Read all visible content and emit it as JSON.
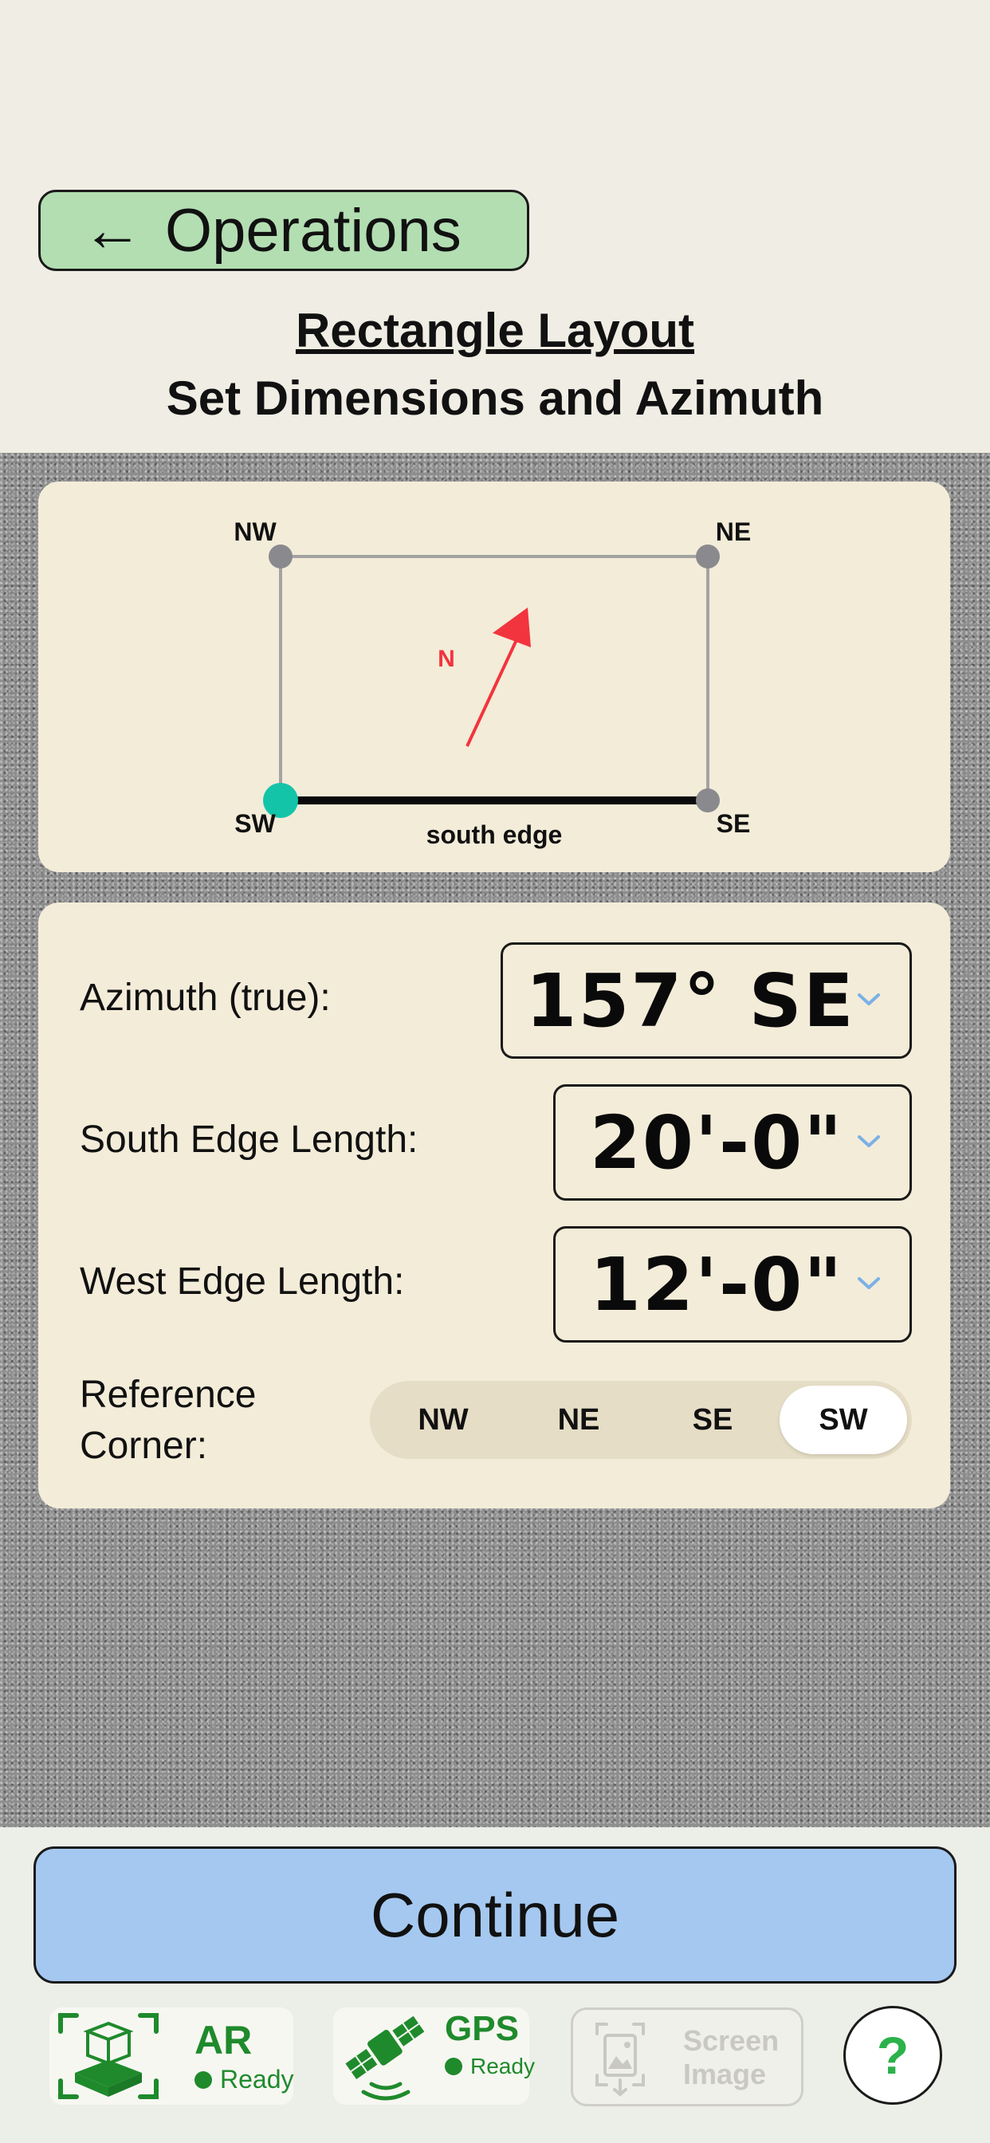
{
  "header": {
    "back_label": "Operations",
    "title": "Rectangle Layout",
    "subtitle": "Set Dimensions and Azimuth"
  },
  "diagram": {
    "corners": {
      "nw": "NW",
      "ne": "NE",
      "se": "SE",
      "sw": "SW"
    },
    "north_label": "N",
    "edge_label": "south edge",
    "colors": {
      "reference_corner": "#14c4a8",
      "north_arrow": "#f2343e",
      "corner": "#8a8a8e"
    }
  },
  "form": {
    "azimuth": {
      "label": "Azimuth (true):",
      "value": "157° SE"
    },
    "south_edge": {
      "label": "South Edge Length:",
      "value": "20'-0\""
    },
    "west_edge": {
      "label": "West Edge Length:",
      "value": "12'-0\""
    },
    "reference_corner": {
      "label_line1": "Reference",
      "label_line2": "Corner:",
      "options": [
        "NW",
        "NE",
        "SE",
        "SW"
      ],
      "selected": "SW"
    }
  },
  "actions": {
    "continue_label": "Continue"
  },
  "status_bar": {
    "ar": {
      "title": "AR",
      "status": "Ready",
      "icon": "ar-cube-icon"
    },
    "gps": {
      "title": "GPS",
      "status": "Ready",
      "icon": "satellite-icon"
    },
    "screen": {
      "line1": "Screen",
      "line2": "Image",
      "icon": "screen-image-icon"
    },
    "help": {
      "label": "?"
    }
  },
  "colors": {
    "accent_green": "#1f8a2c",
    "back_button": "#b3deb2",
    "continue_button": "#a5c8f0",
    "chevron": "#7ab1e6"
  }
}
